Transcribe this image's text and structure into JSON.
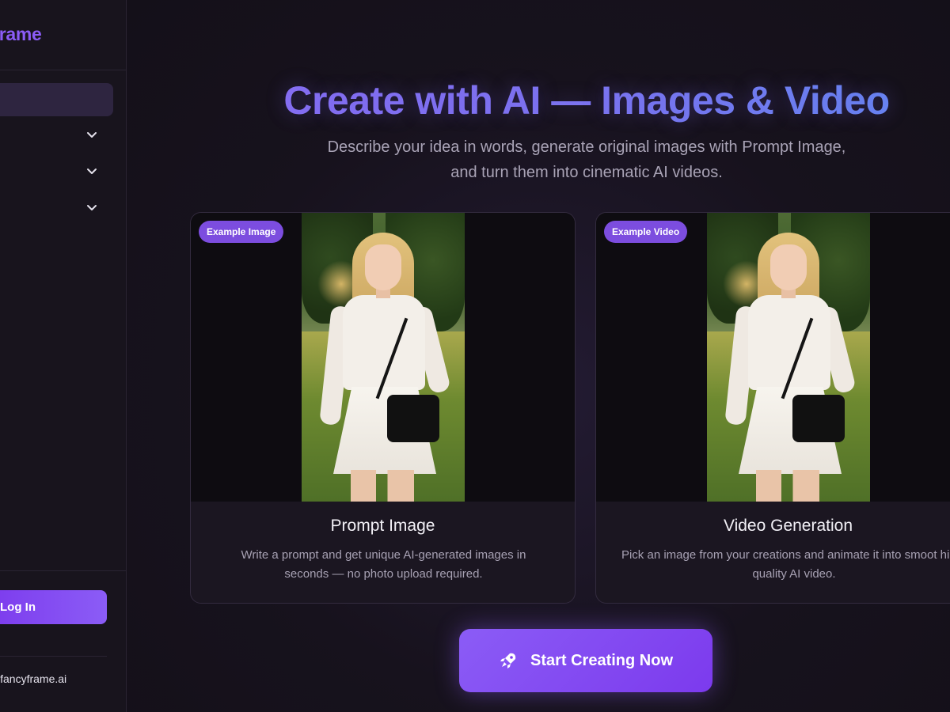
{
  "sidebar": {
    "brand": "cyFrame",
    "login_label": "Log In",
    "support_email": "t@fancyframe.ai",
    "nav_icons": [
      "chevron-down-icon",
      "chevron-down-icon",
      "chevron-down-icon"
    ]
  },
  "hero": {
    "title": "Create with AI — Images & Video",
    "subtitle": "Describe your idea in words, generate original images with Prompt Image, and turn them into cinematic AI videos."
  },
  "cards": [
    {
      "badge": "Example Image",
      "title": "Prompt Image",
      "description": "Write a prompt and get unique AI-generated images in seconds — no photo upload required."
    },
    {
      "badge": "Example Video",
      "title": "Video Generation",
      "description": "Pick an image from your creations and animate it into smoot high-quality AI video."
    }
  ],
  "cta": {
    "label": "Start Creating Now",
    "icon": "rocket-icon"
  },
  "colors": {
    "accent": "#8b5cf6",
    "background": "#141019",
    "title_gradient_start": "#8b6cf2",
    "title_gradient_end": "#5b8ef0"
  }
}
